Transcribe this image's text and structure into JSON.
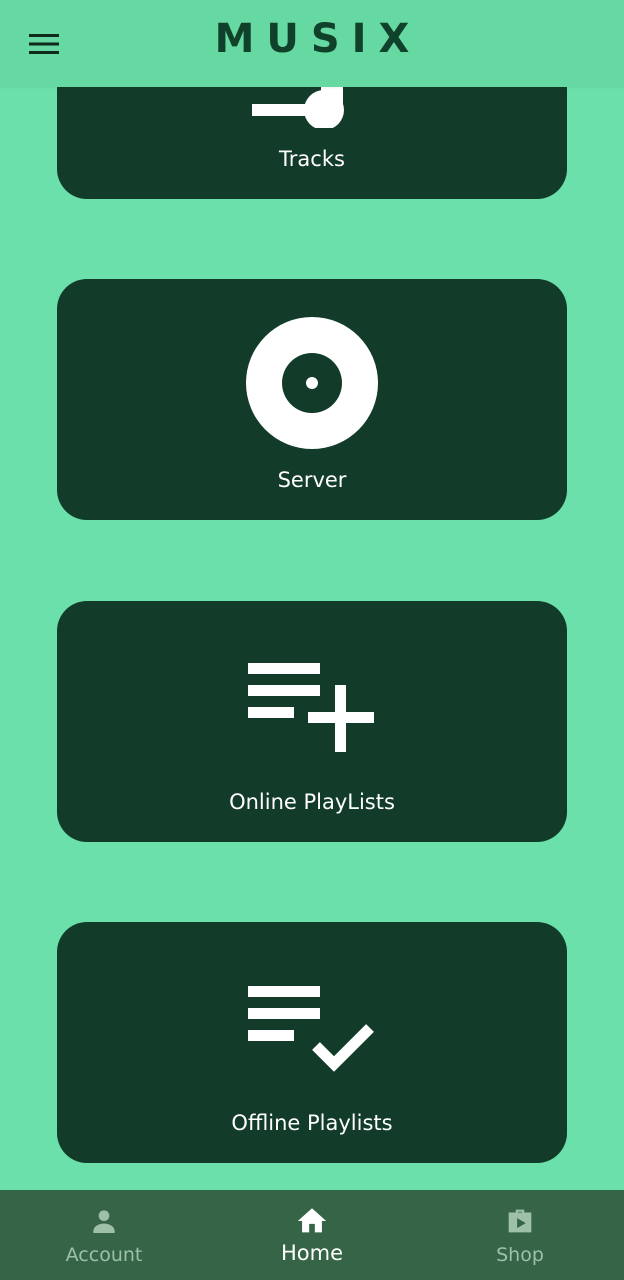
{
  "app": {
    "title": "MUSIX",
    "colors": {
      "background": "#6ce0aa",
      "appbar": "#66d8a2",
      "card": "#123c29",
      "title": "#10412a",
      "bottom_nav": "#356546",
      "nav_inactive": "#9ec0a9",
      "nav_active": "#ffffff"
    }
  },
  "header": {
    "menu_icon": "hamburger-menu-icon"
  },
  "cards": [
    {
      "label": "Tracks",
      "icon": "music-note-icon"
    },
    {
      "label": "Server",
      "icon": "disc-icon"
    },
    {
      "label": "Online PlayLists",
      "icon": "playlist-add-icon"
    },
    {
      "label": "Offline Playlists",
      "icon": "playlist-check-icon"
    }
  ],
  "bottom_nav": {
    "items": [
      {
        "label": "Account",
        "icon": "person-icon",
        "active": false
      },
      {
        "label": "Home",
        "icon": "home-icon",
        "active": true
      },
      {
        "label": "Shop",
        "icon": "shop-icon",
        "active": false
      }
    ]
  }
}
